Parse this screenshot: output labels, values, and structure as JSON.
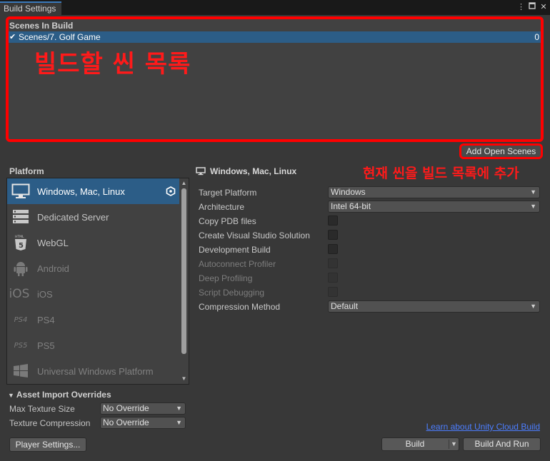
{
  "window": {
    "tab_title": "Build Settings",
    "controls": [
      "more-icon",
      "maximize-icon",
      "close-icon"
    ]
  },
  "scenes": {
    "header": "Scenes In Build",
    "items": [
      {
        "checked": true,
        "name": "Scenes/7. Golf Game",
        "index": "0"
      }
    ],
    "annotation": "빌드할 씬 목록",
    "add_open_label": "Add Open Scenes"
  },
  "platform": {
    "header": "Platform",
    "items": [
      {
        "label": "Windows, Mac, Linux",
        "icon": "monitor-icon",
        "selected": true,
        "enabled": true
      },
      {
        "label": "Dedicated Server",
        "icon": "server-icon",
        "selected": false,
        "enabled": true
      },
      {
        "label": "WebGL",
        "icon": "html5-icon",
        "selected": false,
        "enabled": true
      },
      {
        "label": "Android",
        "icon": "android-icon",
        "selected": false,
        "enabled": false
      },
      {
        "label": "iOS",
        "icon": "ios-icon",
        "selected": false,
        "enabled": false
      },
      {
        "label": "PS4",
        "icon": "ps4-icon",
        "selected": false,
        "enabled": false
      },
      {
        "label": "PS5",
        "icon": "ps5-icon",
        "selected": false,
        "enabled": false
      },
      {
        "label": "Universal Windows Platform",
        "icon": "windows-logo-icon",
        "selected": false,
        "enabled": false
      }
    ]
  },
  "asset_overrides": {
    "header": "Asset Import Overrides",
    "max_texture_label": "Max Texture Size",
    "max_texture_value": "No Override",
    "compression_label": "Texture Compression",
    "compression_value": "No Override"
  },
  "player_settings_label": "Player Settings...",
  "settings": {
    "title": "Windows, Mac, Linux",
    "annotation": "현재 씬을 빌드 목록에 추가",
    "target_platform_label": "Target Platform",
    "target_platform_value": "Windows",
    "architecture_label": "Architecture",
    "architecture_value": "Intel 64-bit",
    "checkboxes": [
      {
        "label": "Copy PDB files",
        "enabled": true,
        "checked": false
      },
      {
        "label": "Create Visual Studio Solution",
        "enabled": true,
        "checked": false
      },
      {
        "label": "Development Build",
        "enabled": true,
        "checked": false
      },
      {
        "label": "Autoconnect Profiler",
        "enabled": false,
        "checked": false
      },
      {
        "label": "Deep Profiling",
        "enabled": false,
        "checked": false
      },
      {
        "label": "Script Debugging",
        "enabled": false,
        "checked": false
      }
    ],
    "compression_label": "Compression Method",
    "compression_value": "Default"
  },
  "footer": {
    "learn_link": "Learn about Unity Cloud Build",
    "build_label": "Build",
    "build_run_label": "Build And Run"
  },
  "colors": {
    "background": "#383838",
    "selection": "#2c5d87",
    "annotation_red": "#ff0000",
    "link": "#4c7eff"
  }
}
